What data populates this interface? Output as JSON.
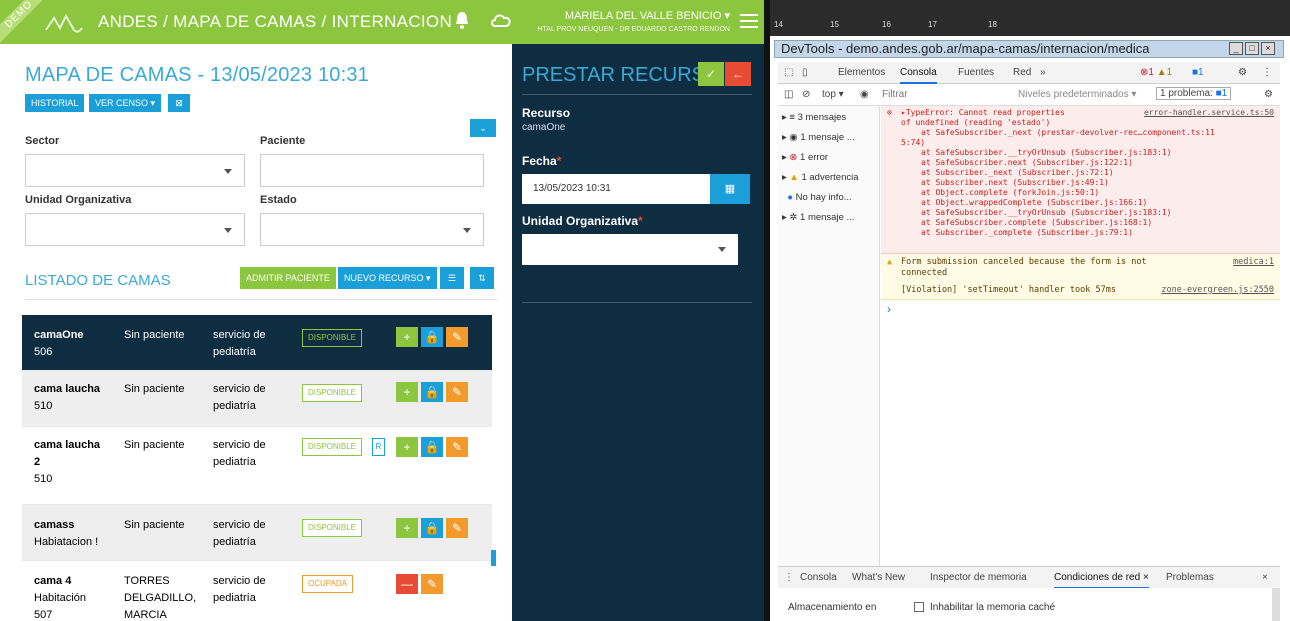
{
  "topbar": {
    "demo": "DEMO",
    "title": "ANDES / MAPA DE CAMAS / INTERNACION",
    "user_name": "MARIELA DEL VALLE BENICIO",
    "user_org": "HTAL PROV NEUQUEN - DR EDUARDO CASTRO RENDON",
    "colors": {
      "brand": "#8cc63f",
      "accent": "#1a9fd9",
      "dark": "#0f2d40"
    }
  },
  "left": {
    "page_title": "MAPA DE CAMAS - 13/05/2023 10:31",
    "btn_historial": "HISTORIAL",
    "btn_censo": "VER CENSO",
    "lbl_sector": "Sector",
    "lbl_paciente": "Paciente",
    "lbl_unidad": "Unidad Organizativa",
    "lbl_estado": "Estado",
    "section_title": "LISTADO DE CAMAS",
    "btn_admitir": "ADMITIR PACIENTE",
    "btn_nuevo": "NUEVO RECURSO",
    "rows": [
      {
        "name": "camaOne",
        "room": "506",
        "patient": "Sin paciente",
        "service1": "servicio de",
        "service2": "pediatría",
        "state": "DISPONIBLE"
      },
      {
        "name": "cama laucha",
        "room": "510",
        "patient": "Sin paciente",
        "service1": "servicio de",
        "service2": "pediatría",
        "state": "DISPONIBLE"
      },
      {
        "name": "cama laucha",
        "name2": "2",
        "room": "510",
        "patient": "Sin paciente",
        "service1": "servicio de",
        "service2": "pediatría",
        "state": "DISPONIBLE",
        "extra": "R"
      },
      {
        "name": "camass",
        "room": "Habiatacion !",
        "patient": "Sin paciente",
        "service1": "servicio de",
        "service2": "pediatría",
        "state": "DISPONIBLE"
      },
      {
        "name": "cama 4",
        "room": "Habitación",
        "room2": "507",
        "patient": "TORRES",
        "patient2": "DELGADILLO,",
        "patient3": "MARCIA",
        "service1": "servicio de",
        "service2": "pediatría",
        "state": "OCUPADA"
      }
    ]
  },
  "panel": {
    "title": "PRESTAR RECURSO",
    "lbl_recurso": "Recurso",
    "val_recurso": "camaOne",
    "lbl_fecha": "Fecha",
    "val_fecha": "13/05/2023 10:31",
    "lbl_unidad": "Unidad Organizativa"
  },
  "devtools": {
    "ruler": [
      "14",
      "15",
      "16",
      "17",
      "18"
    ],
    "window_title": "DevTools - demo.andes.gob.ar/mapa-camas/internacion/medica",
    "tabs": [
      "Elementos",
      "Consola",
      "Fuentes",
      "Red",
      "»"
    ],
    "err_count": "1",
    "warn_count": "1",
    "info_count": "1",
    "context": "top",
    "filter_placeholder": "Filtrar",
    "levels": "Niveles predeterminados",
    "problems": "1 problema:",
    "problems_count": "1",
    "sidebar": [
      "3 mensajes",
      "1 mensaje ...",
      "1 error",
      "1 advertencia",
      "No hay info...",
      "1 mensaje ..."
    ],
    "error_lines": [
      "▸TypeError: Cannot read properties",
      "of undefined (reading 'estado')",
      "at SafeSubscriber._next (prestar-devolver-rec…component.ts:11",
      "5:74)",
      "at SafeSubscriber.__tryOrUnsub (Subscriber.js:183:1)",
      "at SafeSubscriber.next (Subscriber.js:122:1)",
      "at Subscriber._next (Subscriber.js:72:1)",
      "at Subscriber.next (Subscriber.js:49:1)",
      "at Object.complete (forkJoin.js:50:1)",
      "at Object.wrappedComplete (Subscriber.js:166:1)",
      "at SafeSubscriber.__tryOrUnsub (Subscriber.js:183:1)",
      "at SafeSubscriber.complete (Subscriber.js:168:1)",
      "at Subscriber._complete (Subscriber.js:79:1)"
    ],
    "error_source": "error-handler.service.ts:50",
    "warn_text1": "Form submission canceled because the form is not",
    "warn_text2": "connected",
    "warn_source": "medica:1",
    "violation_text": "[Violation] 'setTimeout' handler took 57ms",
    "violation_source": "zone-evergreen.js:2550",
    "prompt": "›",
    "drawer_tabs": [
      "Consola",
      "What's New",
      "Inspector de memoria",
      "Condiciones de red",
      "Problemas"
    ],
    "bottom_left": "Almacenamiento en",
    "bottom_check": "Inhabilitar la memoria caché"
  }
}
